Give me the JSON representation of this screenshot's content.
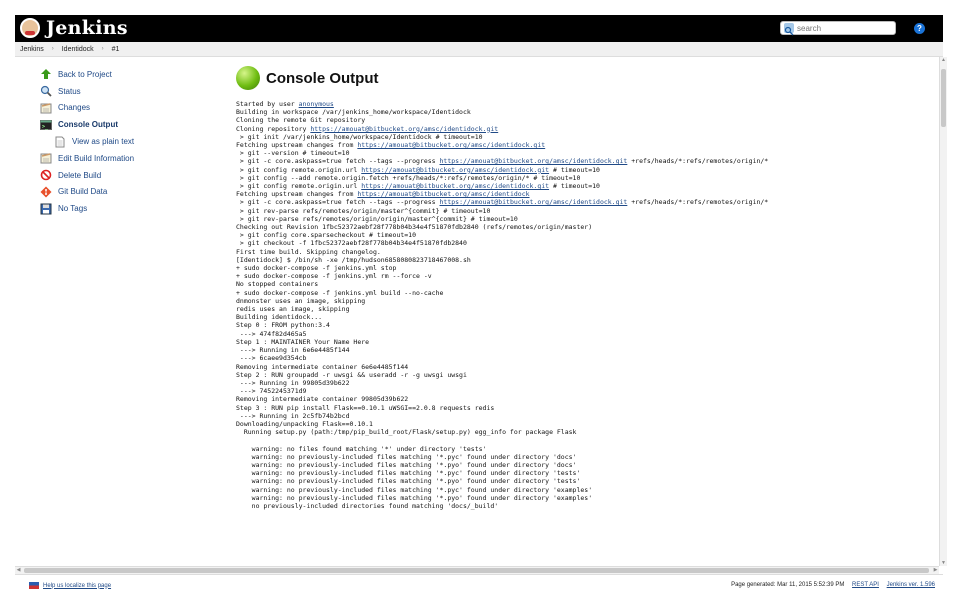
{
  "header": {
    "logo_text": "Jenkins",
    "search_placeholder": "search",
    "help_label": "?"
  },
  "breadcrumb": [
    "Jenkins",
    "Identidock",
    "#1"
  ],
  "sidebar": {
    "items": [
      {
        "label": "Back to Project",
        "icon": "up-arrow-icon"
      },
      {
        "label": "Status",
        "icon": "search-icon"
      },
      {
        "label": "Changes",
        "icon": "notepad-icon"
      },
      {
        "label": "Console Output",
        "icon": "terminal-icon"
      },
      {
        "label": "View as plain text",
        "icon": "document-icon"
      },
      {
        "label": "Edit Build Information",
        "icon": "notepad-icon"
      },
      {
        "label": "Delete Build",
        "icon": "no-entry-icon"
      },
      {
        "label": "Git Build Data",
        "icon": "git-icon"
      },
      {
        "label": "No Tags",
        "icon": "save-icon"
      }
    ]
  },
  "main": {
    "title": "Console Output",
    "lines": [
      [
        "Started by user ",
        {
          "link": "anonymous"
        }
      ],
      [
        "Building in workspace /var/jenkins_home/workspace/Identidock"
      ],
      [
        "Cloning the remote Git repository"
      ],
      [
        "Cloning repository ",
        {
          "link": "https://amouat@bitbucket.org/amsc/identidock.git"
        }
      ],
      [
        " > git init /var/jenkins_home/workspace/Identidock # timeout=10"
      ],
      [
        "Fetching upstream changes from ",
        {
          "link": "https://amouat@bitbucket.org/amsc/identidock.git"
        }
      ],
      [
        " > git --version # timeout=10"
      ],
      [
        " > git -c core.askpass=true fetch --tags --progress ",
        {
          "link": "https://amouat@bitbucket.org/amsc/identidock.git"
        },
        " +refs/heads/*:refs/remotes/origin/*"
      ],
      [
        " > git config remote.origin.url ",
        {
          "link": "https://amouat@bitbucket.org/amsc/identidock.git"
        },
        " # timeout=10"
      ],
      [
        " > git config --add remote.origin.fetch +refs/heads/*:refs/remotes/origin/* # timeout=10"
      ],
      [
        " > git config remote.origin.url ",
        {
          "link": "https://amouat@bitbucket.org/amsc/identidock.git"
        },
        " # timeout=10"
      ],
      [
        "Fetching upstream changes from ",
        {
          "link": "https://amouat@bitbucket.org/amsc/identidock"
        }
      ],
      [
        " > git -c core.askpass=true fetch --tags --progress ",
        {
          "link": "https://amouat@bitbucket.org/amsc/identidock.git"
        },
        " +refs/heads/*:refs/remotes/origin/*"
      ],
      [
        " > git rev-parse refs/remotes/origin/master^{commit} # timeout=10"
      ],
      [
        " > git rev-parse refs/remotes/origin/origin/master^{commit} # timeout=10"
      ],
      [
        "Checking out Revision 1fbc52372aebf28f778b04b34e4f51870fdb2840 (refs/remotes/origin/master)"
      ],
      [
        " > git config core.sparsecheckout # timeout=10"
      ],
      [
        " > git checkout -f 1fbc52372aebf28f778b04b34e4f51870fdb2840"
      ],
      [
        "First time build. Skipping changelog."
      ],
      [
        "[Identidock] $ /bin/sh -xe /tmp/hudson6858080823718467008.sh"
      ],
      [
        "+ sudo docker-compose -f jenkins.yml stop"
      ],
      [
        "+ sudo docker-compose -f jenkins.yml rm --force -v"
      ],
      [
        "No stopped containers"
      ],
      [
        "+ sudo docker-compose -f jenkins.yml build --no-cache"
      ],
      [
        "dnmonster uses an image, skipping"
      ],
      [
        "redis uses an image, skipping"
      ],
      [
        "Building identidock..."
      ],
      [
        "Step 0 : FROM python:3.4"
      ],
      [
        " ---> 474f82d465a5"
      ],
      [
        "Step 1 : MAINTAINER Your Name Here"
      ],
      [
        " ---> Running in 6e6e4485f144"
      ],
      [
        " ---> 6caee9d354cb"
      ],
      [
        "Removing intermediate container 6e6e4485f144"
      ],
      [
        "Step 2 : RUN groupadd -r uwsgi && useradd -r -g uwsgi uwsgi"
      ],
      [
        " ---> Running in 99805d39b622"
      ],
      [
        " ---> 7452245371d9"
      ],
      [
        "Removing intermediate container 99805d39b622"
      ],
      [
        "Step 3 : RUN pip install Flask==0.10.1 uWSGI==2.0.8 requests redis"
      ],
      [
        " ---> Running in 2c5fb74b2bcd"
      ],
      [
        "Downloading/unpacking Flask==0.10.1"
      ],
      [
        "  Running setup.py (path:/tmp/pip_build_root/Flask/setup.py) egg_info for package Flask"
      ],
      [
        ""
      ],
      [
        "    warning: no files found matching '*' under directory 'tests'"
      ],
      [
        "    warning: no previously-included files matching '*.pyc' found under directory 'docs'"
      ],
      [
        "    warning: no previously-included files matching '*.pyo' found under directory 'docs'"
      ],
      [
        "    warning: no previously-included files matching '*.pyc' found under directory 'tests'"
      ],
      [
        "    warning: no previously-included files matching '*.pyo' found under directory 'tests'"
      ],
      [
        "    warning: no previously-included files matching '*.pyc' found under directory 'examples'"
      ],
      [
        "    warning: no previously-included files matching '*.pyo' found under directory 'examples'"
      ],
      [
        "    no previously-included directories found matching 'docs/_build'"
      ]
    ]
  },
  "footer": {
    "localize_link": "Help us localize this page",
    "generated": "Page generated: Mar 11, 2015 5:52:39 PM",
    "rest_api": "REST API",
    "version": "Jenkins ver. 1.596"
  }
}
